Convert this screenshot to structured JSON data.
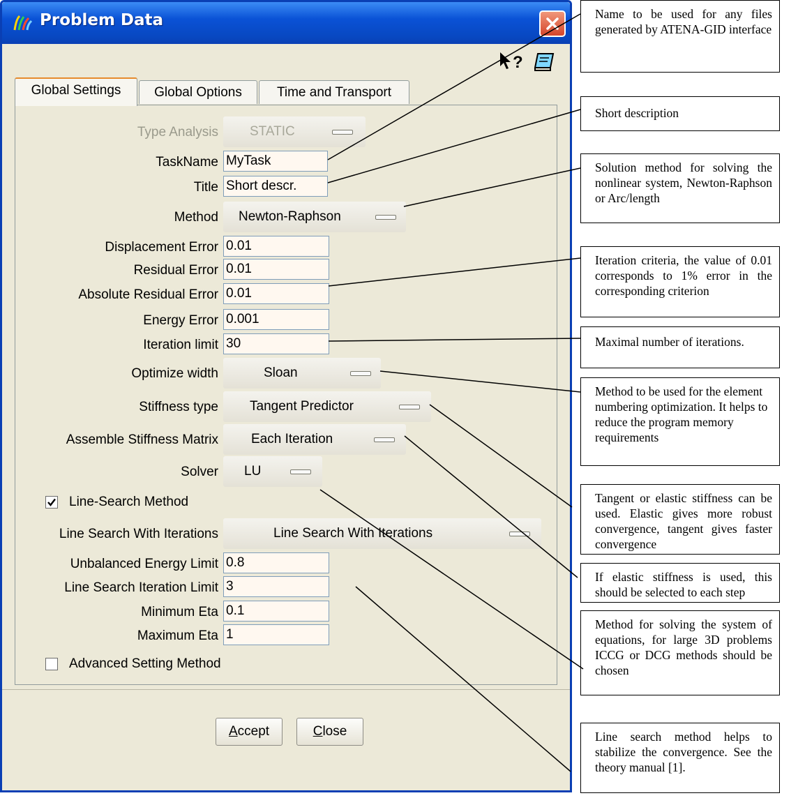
{
  "window": {
    "title": "Problem Data"
  },
  "tabs": [
    {
      "label": "Global Settings"
    },
    {
      "label": "Global Options"
    },
    {
      "label": "Time and Transport"
    }
  ],
  "form": {
    "type_analysis": {
      "label": "Type Analysis",
      "value": "STATIC"
    },
    "task_name": {
      "label": "TaskName",
      "value": "MyTask"
    },
    "title": {
      "label": "Title",
      "value": "Short descr."
    },
    "method": {
      "label": "Method",
      "value": "Newton-Raphson"
    },
    "displacement_error": {
      "label": "Displacement Error",
      "value": "0.01"
    },
    "residual_error": {
      "label": "Residual Error",
      "value": "0.01"
    },
    "absolute_residual_error": {
      "label": "Absolute Residual Error",
      "value": "0.01"
    },
    "energy_error": {
      "label": "Energy Error",
      "value": "0.001"
    },
    "iteration_limit": {
      "label": "Iteration limit",
      "value": "30"
    },
    "optimize_width": {
      "label": "Optimize width",
      "value": "Sloan"
    },
    "stiffness_type": {
      "label": "Stiffness type",
      "value": "Tangent Predictor"
    },
    "assemble_stiffness": {
      "label": "Assemble Stiffness Matrix",
      "value": "Each Iteration"
    },
    "solver": {
      "label": "Solver",
      "value": "LU"
    },
    "line_search_method": {
      "label": "Line-Search Method",
      "checked": true
    },
    "line_search_with_iterations": {
      "label": "Line Search With Iterations",
      "value": "Line Search With Iterations"
    },
    "unbalanced_energy_limit": {
      "label": "Unbalanced Energy Limit",
      "value": "0.8"
    },
    "line_search_iteration_limit": {
      "label": "Line Search Iteration Limit",
      "value": "3"
    },
    "minimum_eta": {
      "label": "Minimum Eta",
      "value": "0.1"
    },
    "maximum_eta": {
      "label": "Maximum Eta",
      "value": "1"
    },
    "advanced_setting_method": {
      "label": "Advanced Setting Method",
      "checked": false
    }
  },
  "buttons": {
    "accept": {
      "label_key": "A",
      "label_rest": "ccept"
    },
    "close": {
      "label_key": "C",
      "label_rest": "lose"
    }
  },
  "annotations": [
    "Name to be used for any files generated by ATENA-GID interface",
    "Short description",
    "Solution method for solving the nonlinear system, Newton-Raphson or Arc/length",
    "Iteration criteria, the value of 0.01 corresponds to 1% error in the corresponding criterion",
    "Maximal number of iterations.",
    "Method to be used for the element numbering optimization. It helps to reduce the program memory requirements",
    "Tangent or elastic stiffness can be used. Elastic gives more robust convergence, tangent gives faster convergence",
    "If elastic stiffness is used, this should be selected to each step",
    "Method for solving the system of equations, for large 3D problems ICCG or DCG methods should be chosen",
    "Line search method helps to stabilize the convergence. See the theory manual [1]."
  ],
  "colors": {
    "titlebar": "#0a52d6",
    "dialog_bg": "#ece9d8",
    "close_button": "#d5452a",
    "field_bg": "#fff8f0"
  }
}
